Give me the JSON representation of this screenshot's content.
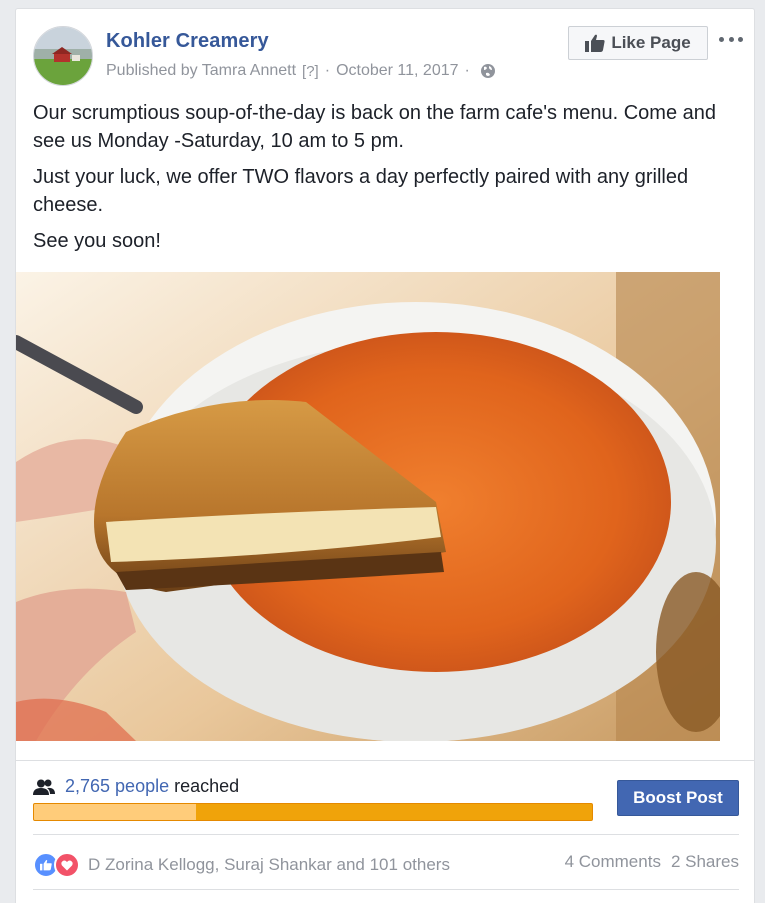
{
  "header": {
    "page_name": "Kohler Creamery",
    "published_by": "Published by Tamra Annett",
    "help_marker": "[?]",
    "separator": "·",
    "date": "October 11, 2017",
    "audience_icon": "globe-icon",
    "like_page_label": "Like Page",
    "more_icon": "ellipsis-icon"
  },
  "post": {
    "paragraphs": [
      "Our scrumptious soup-of-the-day is back on the farm cafe's menu. Come and see us Monday -Saturday, 10 am to 5 pm.",
      "Just your luck, we offer TWO flavors a day perfectly paired with any grilled cheese.",
      "See you soon!"
    ]
  },
  "insights": {
    "people_icon": "people-icon",
    "reach_number": "2,765 people",
    "reach_suffix": "reached",
    "organic_fraction": 0.29,
    "boost_label": "Boost Post"
  },
  "engagement": {
    "reaction_icons": [
      "like-icon",
      "love-icon"
    ],
    "reactors": "D Zorina Kellogg, Suraj Shankar and 101 others",
    "comments": "4 Comments",
    "shares": "2 Shares"
  },
  "colors": {
    "brand_blue": "#4267b2",
    "link_blue": "#365899",
    "reach_bar_paid": "#f0a30a",
    "reach_bar_organic": "#ffcc7a",
    "love_red": "#f25268"
  }
}
